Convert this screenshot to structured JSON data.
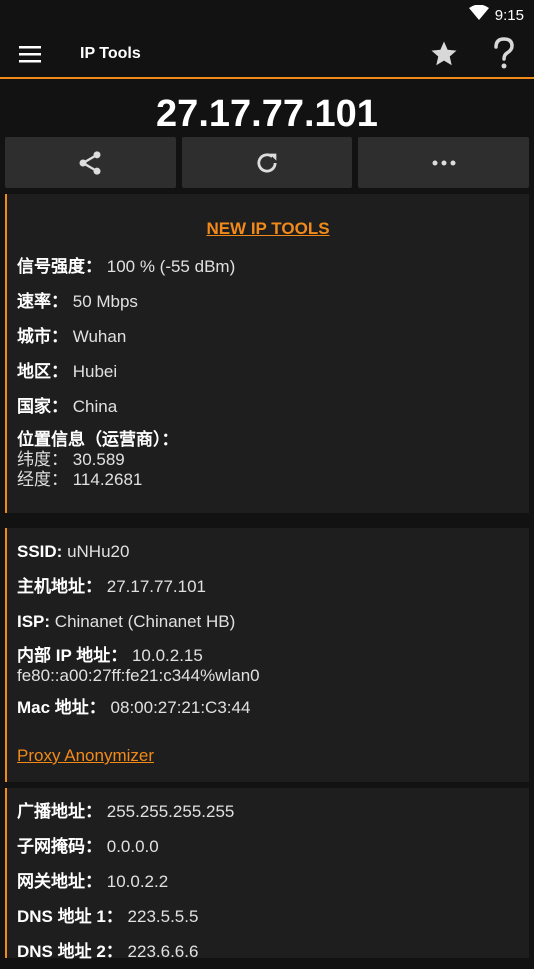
{
  "status": {
    "time": "9:15"
  },
  "appbar": {
    "title": "IP Tools"
  },
  "ip_address": "27.17.77.101",
  "card1": {
    "link": "NEW IP TOOLS",
    "signal_label": "信号强度：",
    "signal_value": "100 % (-55 dBm)",
    "speed_label": "速率：",
    "speed_value": "50 Mbps",
    "city_label": "城市：",
    "city_value": "Wuhan",
    "region_label": "地区：",
    "region_value": "Hubei",
    "country_label": "国家：",
    "country_value": "China",
    "location_label": "位置信息（运营商）：",
    "lat_label": "纬度：",
    "lat_value": "30.589",
    "lon_label": "经度：",
    "lon_value": "114.2681"
  },
  "card2": {
    "ssid_label": "SSID:",
    "ssid_value": "uNHu20",
    "host_label": "主机地址：",
    "host_value": "27.17.77.101",
    "isp_label": "ISP:",
    "isp_value": "Chinanet (Chinanet HB)",
    "internal_label": "内部 IP 地址：",
    "internal_value": "10.0.2.15",
    "ipv6_value": "fe80::a00:27ff:fe21:c344%wlan0",
    "mac_label": "Mac 地址：",
    "mac_value": "08:00:27:21:C3:44",
    "proxy_link": "Proxy Anonymizer"
  },
  "card3": {
    "broadcast_label": "广播地址：",
    "broadcast_value": "255.255.255.255",
    "subnet_label": "子网掩码：",
    "subnet_value": "0.0.0.0",
    "gateway_label": "网关地址：",
    "gateway_value": "10.0.2.2",
    "dns1_label": "DNS 地址 1：",
    "dns1_value": "223.5.5.5",
    "dns2_label": "DNS 地址 2：",
    "dns2_value": "223.6.6.6"
  },
  "colors": {
    "accent": "#f28a1a",
    "background": "#121212",
    "card": "#1e1e1e",
    "button": "#2e2e2e"
  }
}
